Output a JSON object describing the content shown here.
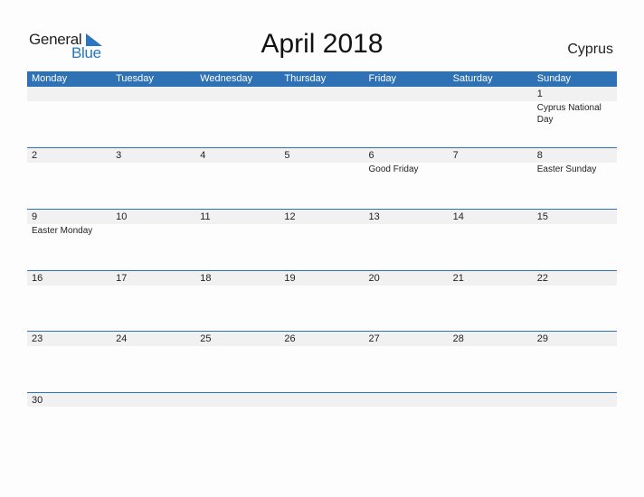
{
  "logo": {
    "line1": "General",
    "line2": "Blue"
  },
  "title": "April 2018",
  "country": "Cyprus",
  "colors": {
    "accent": "#2e72b5",
    "strip": "#f1f1f1"
  },
  "weekdays": [
    "Monday",
    "Tuesday",
    "Wednesday",
    "Thursday",
    "Friday",
    "Saturday",
    "Sunday"
  ],
  "weeks": [
    [
      {
        "n": "",
        "e": ""
      },
      {
        "n": "",
        "e": ""
      },
      {
        "n": "",
        "e": ""
      },
      {
        "n": "",
        "e": ""
      },
      {
        "n": "",
        "e": ""
      },
      {
        "n": "",
        "e": ""
      },
      {
        "n": "1",
        "e": "Cyprus National Day"
      }
    ],
    [
      {
        "n": "2",
        "e": ""
      },
      {
        "n": "3",
        "e": ""
      },
      {
        "n": "4",
        "e": ""
      },
      {
        "n": "5",
        "e": ""
      },
      {
        "n": "6",
        "e": "Good Friday"
      },
      {
        "n": "7",
        "e": ""
      },
      {
        "n": "8",
        "e": "Easter Sunday"
      }
    ],
    [
      {
        "n": "9",
        "e": "Easter Monday"
      },
      {
        "n": "10",
        "e": ""
      },
      {
        "n": "11",
        "e": ""
      },
      {
        "n": "12",
        "e": ""
      },
      {
        "n": "13",
        "e": ""
      },
      {
        "n": "14",
        "e": ""
      },
      {
        "n": "15",
        "e": ""
      }
    ],
    [
      {
        "n": "16",
        "e": ""
      },
      {
        "n": "17",
        "e": ""
      },
      {
        "n": "18",
        "e": ""
      },
      {
        "n": "19",
        "e": ""
      },
      {
        "n": "20",
        "e": ""
      },
      {
        "n": "21",
        "e": ""
      },
      {
        "n": "22",
        "e": ""
      }
    ],
    [
      {
        "n": "23",
        "e": ""
      },
      {
        "n": "24",
        "e": ""
      },
      {
        "n": "25",
        "e": ""
      },
      {
        "n": "26",
        "e": ""
      },
      {
        "n": "27",
        "e": ""
      },
      {
        "n": "28",
        "e": ""
      },
      {
        "n": "29",
        "e": ""
      }
    ],
    [
      {
        "n": "30",
        "e": ""
      },
      {
        "n": "",
        "e": ""
      },
      {
        "n": "",
        "e": ""
      },
      {
        "n": "",
        "e": ""
      },
      {
        "n": "",
        "e": ""
      },
      {
        "n": "",
        "e": ""
      },
      {
        "n": "",
        "e": ""
      }
    ]
  ]
}
